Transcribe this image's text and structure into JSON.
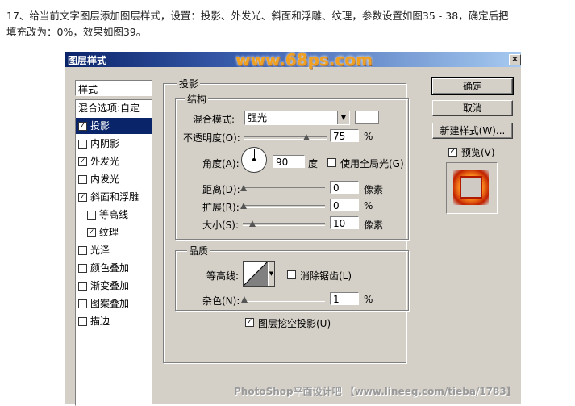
{
  "intro": {
    "line1": "17、给当前文字图层添加图层样式，设置：投影、外发光、斜面和浮雕、纹理，参数设置如图35 - 38，确定后把",
    "line2": "填充改为：0%，效果如图39。"
  },
  "dialog": {
    "title": "图层样式",
    "watermark": "www.68ps.com",
    "close": "×"
  },
  "left_panel": {
    "header": "样式",
    "items": [
      {
        "label": "混合选项:自定",
        "checkbox": false,
        "checked": false,
        "selected": false,
        "indent": false
      },
      {
        "label": "投影",
        "checkbox": true,
        "checked": true,
        "selected": true,
        "indent": false
      },
      {
        "label": "内阴影",
        "checkbox": true,
        "checked": false,
        "selected": false,
        "indent": false
      },
      {
        "label": "外发光",
        "checkbox": true,
        "checked": true,
        "selected": false,
        "indent": false
      },
      {
        "label": "内发光",
        "checkbox": true,
        "checked": false,
        "selected": false,
        "indent": false
      },
      {
        "label": "斜面和浮雕",
        "checkbox": true,
        "checked": true,
        "selected": false,
        "indent": false
      },
      {
        "label": "等高线",
        "checkbox": true,
        "checked": false,
        "selected": false,
        "indent": true
      },
      {
        "label": "纹理",
        "checkbox": true,
        "checked": true,
        "selected": false,
        "indent": true
      },
      {
        "label": "光泽",
        "checkbox": true,
        "checked": false,
        "selected": false,
        "indent": false
      },
      {
        "label": "颜色叠加",
        "checkbox": true,
        "checked": false,
        "selected": false,
        "indent": false
      },
      {
        "label": "渐变叠加",
        "checkbox": true,
        "checked": false,
        "selected": false,
        "indent": false
      },
      {
        "label": "图案叠加",
        "checkbox": true,
        "checked": false,
        "selected": false,
        "indent": false
      },
      {
        "label": "描边",
        "checkbox": true,
        "checked": false,
        "selected": false,
        "indent": false
      }
    ]
  },
  "shadow": {
    "group_title": "投影",
    "structure": {
      "title": "结构",
      "blend_mode_label": "混合模式:",
      "blend_mode_value": "强光",
      "opacity_label": "不透明度(O):",
      "opacity_value": "75",
      "opacity_pct": 0.75,
      "opacity_unit": "%",
      "angle_label": "角度(A):",
      "angle_value": "90",
      "angle_unit": "度",
      "global_light_label": "使用全局光(G)",
      "global_light_checked": false,
      "distance_label": "距离(D):",
      "distance_value": "0",
      "distance_unit": "像素",
      "spread_label": "扩展(R):",
      "spread_value": "0",
      "spread_unit": "%",
      "size_label": "大小(S):",
      "size_value": "10",
      "size_unit": "像素"
    },
    "quality": {
      "title": "品质",
      "contour_label": "等高线:",
      "antialias_label": "消除锯齿(L)",
      "antialias_checked": false,
      "noise_label": "杂色(N):",
      "noise_value": "1",
      "noise_unit": "%"
    },
    "knockout_label": "图层挖空投影(U)",
    "knockout_checked": true
  },
  "buttons": {
    "ok": "确定",
    "cancel": "取消",
    "new_style": "新建样式(W)...",
    "preview_label": "预览(V)",
    "preview_checked": true
  },
  "footer": "PhotoShop平面设计吧 【www.lineeg.com/tieba/1783】",
  "colors": {
    "dialog_bg": "#d4d0c8",
    "title_gradient_start": "#0a246a",
    "selected_item": "#0a246a"
  }
}
